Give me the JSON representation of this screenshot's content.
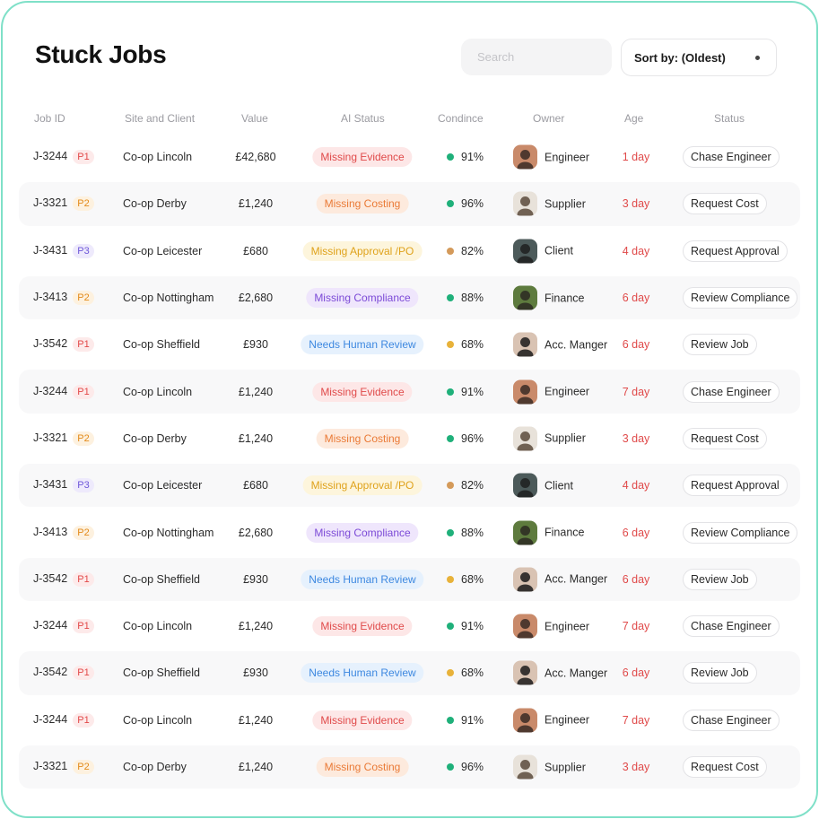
{
  "title": "Stuck Jobs",
  "search": {
    "placeholder": "Search"
  },
  "sort": {
    "label": "Sort by: (Oldest)"
  },
  "columns": [
    "Job ID",
    "Site and Client",
    "Value",
    "AI Status",
    "Condince",
    "Owner",
    "Age",
    "Status"
  ],
  "colors": {
    "accent_border": "#7fe0c8",
    "confidence_high": "#1fb07a",
    "confidence_mid": "#d49a5a",
    "confidence_low": "#e8b23a",
    "age": "#e04a4a"
  },
  "rows": [
    {
      "id": "J-3244",
      "priority": "P1",
      "site": "Co-op Lincoln",
      "value": "£42,680",
      "ai_status": "Missing Evidence",
      "confidence": "91%",
      "owner": "Engineer",
      "age": "1 day",
      "action": "Chase Engineer"
    },
    {
      "id": "J-3321",
      "priority": "P2",
      "site": "Co-op Derby",
      "value": "£1,240",
      "ai_status": "Missing Costing",
      "confidence": "96%",
      "owner": "Supplier",
      "age": "3 day",
      "action": "Request Cost"
    },
    {
      "id": "J-3431",
      "priority": "P3",
      "site": "Co-op Leicester",
      "value": "£680",
      "ai_status": "Missing Approval /PO",
      "confidence": "82%",
      "owner": "Client",
      "age": "4 day",
      "action": "Request Approval"
    },
    {
      "id": "J-3413",
      "priority": "P2",
      "site": "Co-op Nottingham",
      "value": "£2,680",
      "ai_status": "Missing Compliance",
      "confidence": "88%",
      "owner": "Finance",
      "age": "6 day",
      "action": "Review Compliance"
    },
    {
      "id": "J-3542",
      "priority": "P1",
      "site": "Co-op Sheffield",
      "value": "£930",
      "ai_status": "Needs Human Review",
      "confidence": "68%",
      "owner": "Acc. Manger",
      "age": "6 day",
      "action": "Review Job"
    },
    {
      "id": "J-3244",
      "priority": "P1",
      "site": "Co-op Lincoln",
      "value": "£1,240",
      "ai_status": "Missing Evidence",
      "confidence": "91%",
      "owner": "Engineer",
      "age": "7 day",
      "action": "Chase Engineer"
    },
    {
      "id": "J-3321",
      "priority": "P2",
      "site": "Co-op Derby",
      "value": "£1,240",
      "ai_status": "Missing Costing",
      "confidence": "96%",
      "owner": "Supplier",
      "age": "3 day",
      "action": "Request Cost"
    },
    {
      "id": "J-3431",
      "priority": "P3",
      "site": "Co-op Leicester",
      "value": "£680",
      "ai_status": "Missing Approval /PO",
      "confidence": "82%",
      "owner": "Client",
      "age": "4 day",
      "action": "Request Approval"
    },
    {
      "id": "J-3413",
      "priority": "P2",
      "site": "Co-op Nottingham",
      "value": "£2,680",
      "ai_status": "Missing Compliance",
      "confidence": "88%",
      "owner": "Finance",
      "age": "6 day",
      "action": "Review Compliance"
    },
    {
      "id": "J-3542",
      "priority": "P1",
      "site": "Co-op Sheffield",
      "value": "£930",
      "ai_status": "Needs Human Review",
      "confidence": "68%",
      "owner": "Acc. Manger",
      "age": "6 day",
      "action": "Review Job"
    },
    {
      "id": "J-3244",
      "priority": "P1",
      "site": "Co-op Lincoln",
      "value": "£1,240",
      "ai_status": "Missing Evidence",
      "confidence": "91%",
      "owner": "Engineer",
      "age": "7 day",
      "action": "Chase Engineer"
    },
    {
      "id": "J-3542",
      "priority": "P1",
      "site": "Co-op Sheffield",
      "value": "£930",
      "ai_status": "Needs Human Review",
      "confidence": "68%",
      "owner": "Acc. Manger",
      "age": "6 day",
      "action": "Review Job"
    },
    {
      "id": "J-3244",
      "priority": "P1",
      "site": "Co-op Lincoln",
      "value": "£1,240",
      "ai_status": "Missing Evidence",
      "confidence": "91%",
      "owner": "Engineer",
      "age": "7 day",
      "action": "Chase Engineer"
    },
    {
      "id": "J-3321",
      "priority": "P2",
      "site": "Co-op Derby",
      "value": "£1,240",
      "ai_status": "Missing Costing",
      "confidence": "96%",
      "owner": "Supplier",
      "age": "3 day",
      "action": "Request Cost"
    }
  ]
}
